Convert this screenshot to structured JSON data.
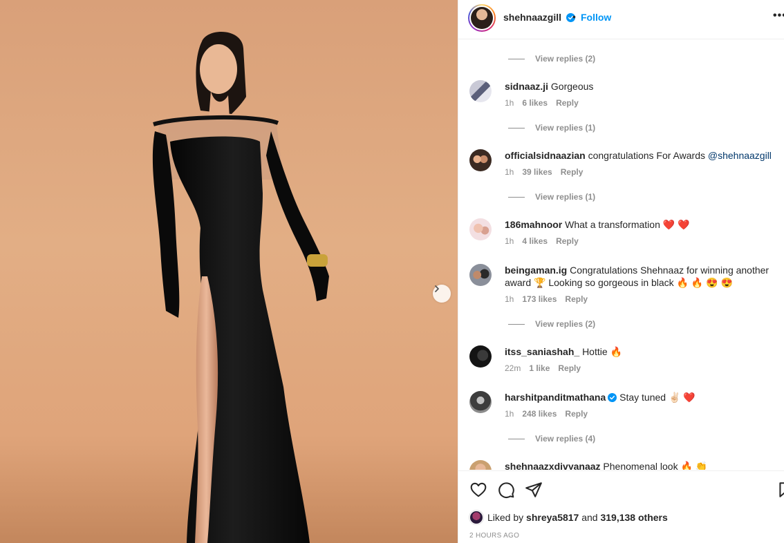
{
  "post": {
    "author": "shehnaazgill",
    "follow_label": "Follow",
    "separator": "•",
    "more_label": "•••",
    "next_label": "›"
  },
  "comments": [
    {
      "kind": "replies",
      "label": "View replies (2)"
    },
    {
      "kind": "comment",
      "user": "sidnaaz.ji",
      "text": "Gorgeous",
      "time": "1h",
      "likes": "6 likes",
      "reply": "Reply"
    },
    {
      "kind": "replies",
      "label": "View replies (1)"
    },
    {
      "kind": "comment",
      "user": "officialsidnaazian",
      "text": "congratulations For Awards ",
      "mention": "@shehnaazgill",
      "time": "1h",
      "likes": "39 likes",
      "reply": "Reply"
    },
    {
      "kind": "replies",
      "label": "View replies (1)"
    },
    {
      "kind": "comment",
      "user": "186mahnoor",
      "text": "What a transformation ❤️ ❤️",
      "time": "1h",
      "likes": "4 likes",
      "reply": "Reply"
    },
    {
      "kind": "comment",
      "user": "beingaman.ig",
      "text": "Congratulations Shehnaaz for winning another award 🏆 Looking so gorgeous in black 🔥 🔥 😍 😍",
      "time": "1h",
      "likes": "173 likes",
      "reply": "Reply"
    },
    {
      "kind": "replies",
      "label": "View replies (2)"
    },
    {
      "kind": "comment",
      "user": "itss_saniashah_",
      "text": "Hottie 🔥",
      "time": "22m",
      "likes": "1 like",
      "reply": "Reply"
    },
    {
      "kind": "comment",
      "user": "harshitpanditmathana",
      "verified": true,
      "text": "Stay tuned ✌🏻 ❤️",
      "time": "1h",
      "likes": "248 likes",
      "reply": "Reply"
    },
    {
      "kind": "replies",
      "label": "View replies (4)"
    },
    {
      "kind": "comment",
      "user": "shehnaazxdivyanaaz",
      "text": "Phenomenal look 🔥 👏",
      "time": "",
      "likes": "",
      "reply": ""
    }
  ],
  "footer": {
    "liked_prefix": "Liked by ",
    "liked_user": "shreya5817",
    "liked_and": " and ",
    "liked_others": "319,138 others",
    "timestamp": "2 HOURS AGO"
  },
  "icons": [
    "heart-icon",
    "comment-icon",
    "share-icon",
    "bookmark-icon",
    "verified-icon",
    "chevron-right-icon"
  ],
  "colors": {
    "link": "#0095f6",
    "secondary": "#8e8e8e",
    "mention": "#00376b",
    "background_photo": "#e0a87f"
  }
}
